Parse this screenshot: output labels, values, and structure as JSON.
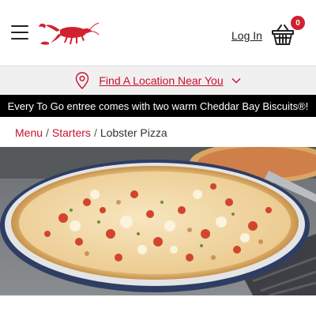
{
  "header": {
    "logo_icon": "lobster-logo",
    "menu_icon": "hamburger-menu-icon",
    "login_label": "Log In",
    "cart_icon": "basket-icon",
    "cart_count": "0"
  },
  "location": {
    "icon": "map-pin-icon",
    "label": "Find A Location Near You",
    "chevron_icon": "chevron-down-icon"
  },
  "promo": {
    "text": "Every To Go entree comes with two warm Cheddar Bay Biscuits®!"
  },
  "breadcrumb": {
    "items": [
      "Menu",
      "Starters"
    ],
    "current": "Lobster Pizza",
    "separator": "/"
  },
  "colors": {
    "brand_red": "#c8102e",
    "badge_red": "#d12030",
    "promo_bg": "#000000",
    "location_bg": "#f0f0f0"
  }
}
